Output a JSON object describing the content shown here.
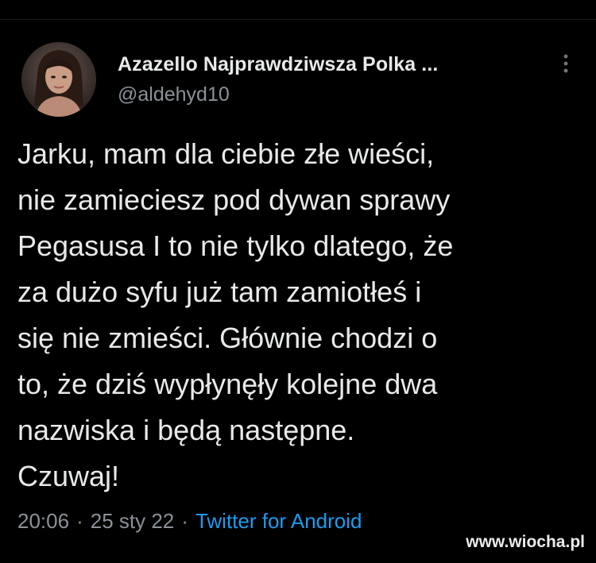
{
  "tweet": {
    "author": {
      "display_name": "Azazello Najprawdziwsza Polka ...",
      "handle": "@aldehyd10",
      "avatar_icon": "profile-photo"
    },
    "more_icon": "more-vertical-icon",
    "text": "Jarku, mam dla ciebie złe wieści,\nnie zamieciesz pod dywan sprawy\nPegasusa I to nie tylko dlatego, że\nza dużo syfu już tam zamiotłeś i\nsię nie zmieści. Głównie chodzi o\nto, że dziś wypłynęły kolejne dwa\nnazwiska i będą następne.\nCzuwaj!",
    "time": "20:06",
    "date": "25 sty 22",
    "separator": "·",
    "source": "Twitter for Android"
  },
  "watermark": "www.wiocha.pl",
  "colors": {
    "background": "#000000",
    "text": "#e7e9ea",
    "secondary_text": "#8b9198",
    "link": "#1d9bf0"
  }
}
